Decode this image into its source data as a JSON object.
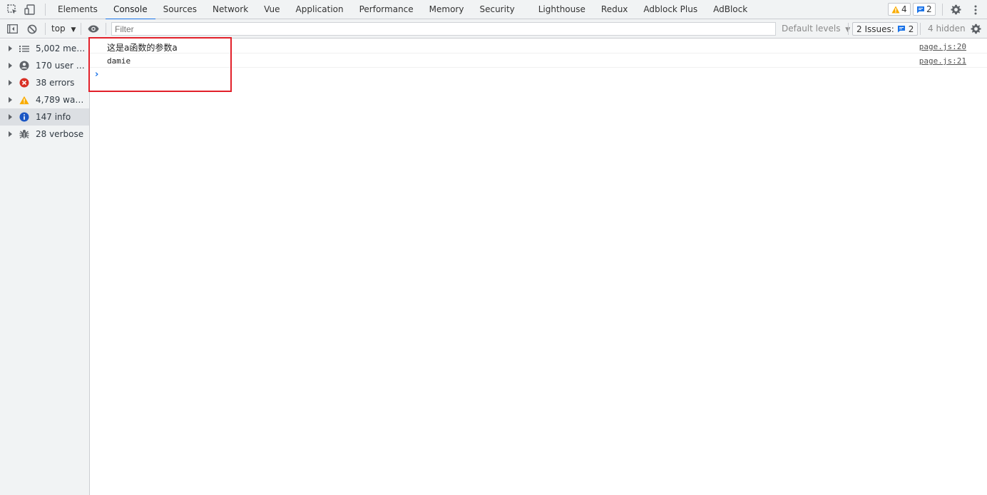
{
  "tabs": [
    "Elements",
    "Console",
    "Sources",
    "Network",
    "Vue",
    "Application",
    "Performance",
    "Memory",
    "Security",
    "Lighthouse",
    "Redux",
    "Adblock Plus",
    "AdBlock"
  ],
  "active_tab": "Console",
  "header_badges": {
    "warnings": "4",
    "messages": "2"
  },
  "toolbar": {
    "context": "top",
    "filter_placeholder": "Filter",
    "levels": "Default levels",
    "issues_label": "2 Issues:",
    "issues_count": "2",
    "hidden": "4 hidden"
  },
  "sidebar": {
    "items": [
      {
        "label": "5,002 messa...",
        "icon": "list-icon"
      },
      {
        "label": "170 user me...",
        "icon": "user-icon"
      },
      {
        "label": "38 errors",
        "icon": "error-icon"
      },
      {
        "label": "4,789 warni...",
        "icon": "warning-icon"
      },
      {
        "label": "147 info",
        "icon": "info-icon"
      },
      {
        "label": "28 verbose",
        "icon": "bug-icon"
      }
    ],
    "selected_index": 4
  },
  "messages": [
    {
      "text": "这是a函数的参数a",
      "source": "page.js:20"
    },
    {
      "text": "damie",
      "source": "page.js:21"
    }
  ],
  "prompt_symbol": "›",
  "colors": {
    "accent": "#1a73e8",
    "error": "#d93025",
    "warning": "#f9ab00",
    "highlight": "#e2202a"
  }
}
